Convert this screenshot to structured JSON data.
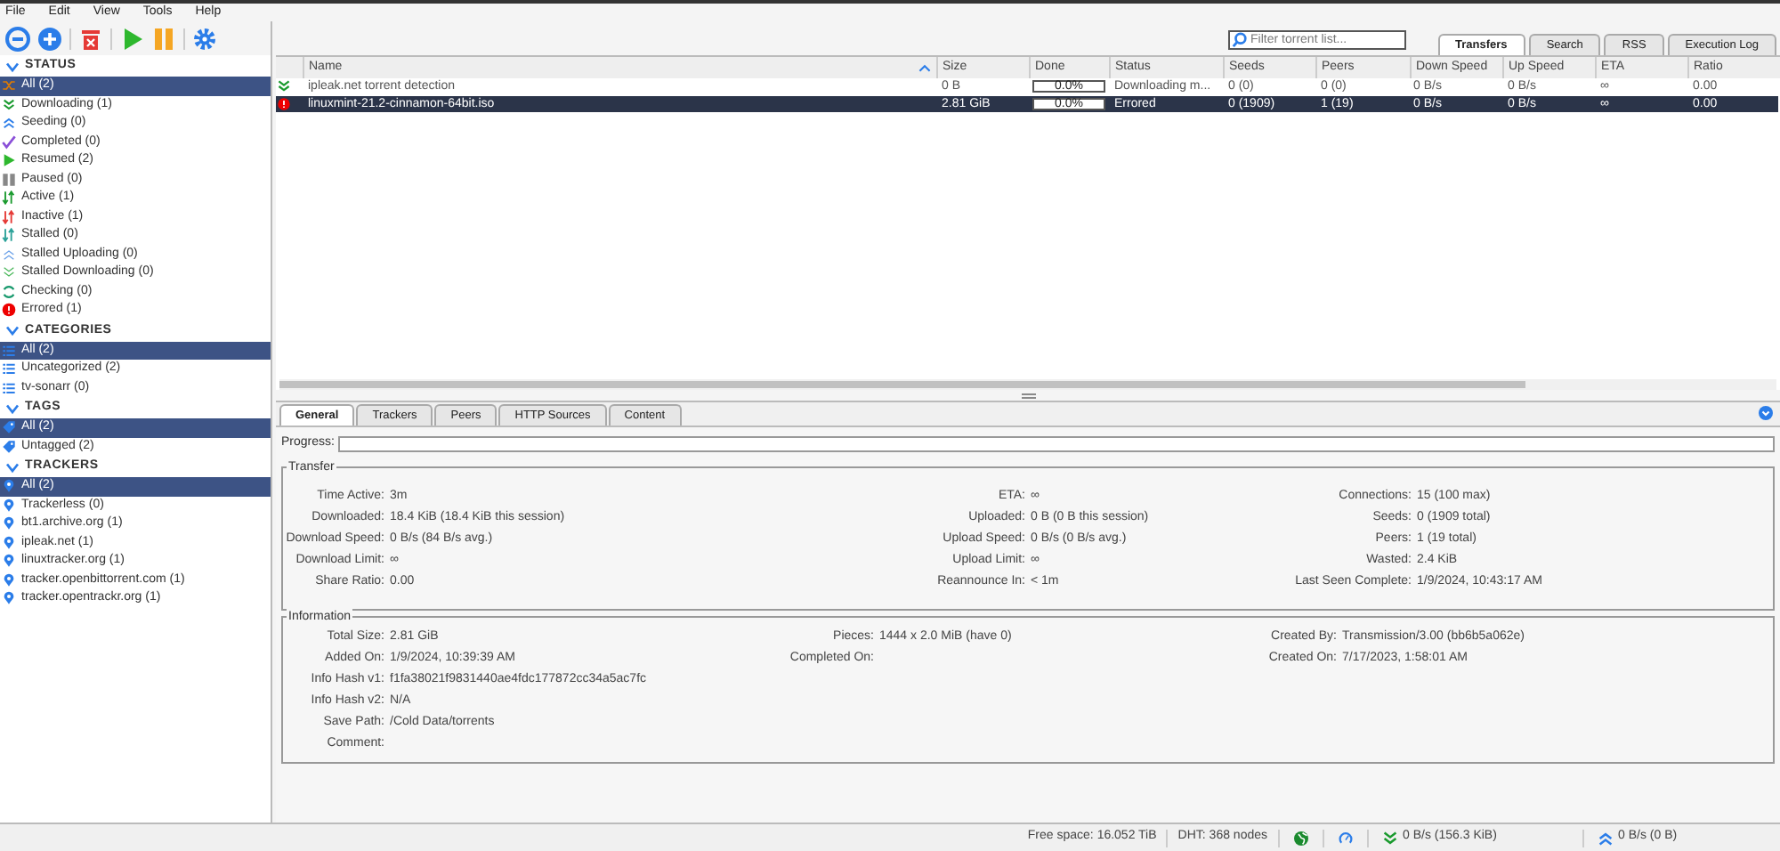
{
  "menu": [
    "File",
    "Edit",
    "View",
    "Tools",
    "Help"
  ],
  "filter": {
    "placeholder": "Filter torrent list..."
  },
  "main_tabs": [
    {
      "label": "Transfers",
      "selected": true
    },
    {
      "label": "Search",
      "selected": false
    },
    {
      "label": "RSS",
      "selected": false
    },
    {
      "label": "Execution Log",
      "selected": false
    }
  ],
  "sidebar": [
    {
      "title": "STATUS",
      "kind": "status",
      "expanded": true,
      "items": [
        {
          "label": "All (2)",
          "selected": true
        },
        {
          "label": "Downloading (1)",
          "selected": false
        },
        {
          "label": "Seeding (0)",
          "selected": false
        },
        {
          "label": "Completed (0)",
          "selected": false
        },
        {
          "label": "Resumed (2)",
          "selected": false
        },
        {
          "label": "Paused (0)",
          "selected": false
        },
        {
          "label": "Active (1)",
          "selected": false
        },
        {
          "label": "Inactive (1)",
          "selected": false
        },
        {
          "label": "Stalled (0)",
          "selected": false
        },
        {
          "label": "Stalled Uploading (0)",
          "selected": false
        },
        {
          "label": "Stalled Downloading (0)",
          "selected": false
        },
        {
          "label": "Checking (0)",
          "selected": false
        },
        {
          "label": "Errored (1)",
          "selected": false
        }
      ]
    },
    {
      "title": "CATEGORIES",
      "kind": "category",
      "expanded": true,
      "items": [
        {
          "label": "All (2)",
          "selected": true
        },
        {
          "label": "Uncategorized (2)",
          "selected": false
        },
        {
          "label": "tv-sonarr (0)",
          "selected": false
        }
      ]
    },
    {
      "title": "TAGS",
      "kind": "tag",
      "expanded": true,
      "items": [
        {
          "label": "All (2)",
          "selected": true
        },
        {
          "label": "Untagged (2)",
          "selected": false
        }
      ]
    },
    {
      "title": "TRACKERS",
      "kind": "tracker",
      "expanded": true,
      "items": [
        {
          "label": "All (2)",
          "selected": true
        },
        {
          "label": "Trackerless (0)",
          "selected": false
        },
        {
          "label": "bt1.archive.org (1)",
          "selected": false
        },
        {
          "label": "ipleak.net (1)",
          "selected": false
        },
        {
          "label": "linuxtracker.org (1)",
          "selected": false
        },
        {
          "label": "tracker.openbittorrent.com (1)",
          "selected": false
        },
        {
          "label": "tracker.opentrackr.org (1)",
          "selected": false
        }
      ]
    }
  ],
  "table": {
    "columns": [
      "Name",
      "Size",
      "Done",
      "Status",
      "Seeds",
      "Peers",
      "Down Speed",
      "Up Speed",
      "ETA",
      "Ratio"
    ],
    "rows": [
      {
        "kind": "downloading",
        "selected": false,
        "name": "ipleak.net torrent detection",
        "size": "0 B",
        "done": "0.0%",
        "level": 0,
        "status": "Downloading m...",
        "seeds": "0 (0)",
        "peers": "0 (0)",
        "down_speed": "0 B/s",
        "up_speed": "0 B/s",
        "eta": "∞",
        "ratio": "0.00"
      },
      {
        "kind": "errored",
        "selected": true,
        "name": "linuxmint-21.2-cinnamon-64bit.iso",
        "size": "2.81 GiB",
        "done": "0.0%",
        "level": 0,
        "status": "Errored",
        "seeds": "0 (1909)",
        "peers": "1 (19)",
        "down_speed": "0 B/s",
        "up_speed": "0 B/s",
        "eta": "∞",
        "ratio": "0.00"
      }
    ]
  },
  "detail_tabs": [
    {
      "label": "General",
      "selected": true
    },
    {
      "label": "Trackers",
      "selected": false
    },
    {
      "label": "Peers",
      "selected": false
    },
    {
      "label": "HTTP Sources",
      "selected": false
    },
    {
      "label": "Content",
      "selected": false
    }
  ],
  "progress": {
    "label": "Progress:",
    "level": 0
  },
  "transfer": {
    "title": "Transfer",
    "rows": [
      [
        {
          "label": "Time Active:",
          "value": "3m"
        },
        {
          "label": "ETA:",
          "value": "∞"
        },
        {
          "label": "Connections:",
          "value": "15 (100 max)"
        }
      ],
      [
        {
          "label": "Downloaded:",
          "value": "18.4 KiB (18.4 KiB this session)"
        },
        {
          "label": "Uploaded:",
          "value": "0 B (0 B this session)"
        },
        {
          "label": "Seeds:",
          "value": "0 (1909 total)"
        }
      ],
      [
        {
          "label": "Download Speed:",
          "value": "0 B/s (84 B/s avg.)"
        },
        {
          "label": "Upload Speed:",
          "value": "0 B/s (0 B/s avg.)"
        },
        {
          "label": "Peers:",
          "value": "1 (19 total)"
        }
      ],
      [
        {
          "label": "Download Limit:",
          "value": "∞"
        },
        {
          "label": "Upload Limit:",
          "value": "∞"
        },
        {
          "label": "Wasted:",
          "value": "2.4 KiB"
        }
      ],
      [
        {
          "label": "Share Ratio:",
          "value": "0.00"
        },
        {
          "label": "Reannounce In:",
          "value": "< 1m"
        },
        {
          "label": "Last Seen Complete:",
          "value": "1/9/2024, 10:43:17 AM"
        }
      ]
    ]
  },
  "information": {
    "title": "Information",
    "rows": [
      [
        {
          "label": "Total Size:",
          "value": "2.81 GiB"
        },
        {
          "label": "Pieces:",
          "value": "1444 x 2.0 MiB (have 0)"
        },
        {
          "label": "Created By:",
          "value": "Transmission/3.00 (bb6b5a062e)"
        }
      ],
      [
        {
          "label": "Added On:",
          "value": "1/9/2024, 10:39:39 AM"
        },
        {
          "label": "Completed On:"
        },
        {
          "label": "Created On:",
          "value": "7/17/2023, 1:58:01 AM"
        }
      ],
      [
        {
          "label": "Info Hash v1:",
          "value": "f1fa38021f9831440ae4fdc177872cc34a5ac7fc"
        }
      ],
      [
        {
          "label": "Info Hash v2:",
          "value": "N/A"
        }
      ],
      [
        {
          "label": "Save Path:",
          "value": "/Cold Data/torrents"
        }
      ],
      [
        {
          "label": "Comment:"
        }
      ]
    ]
  },
  "status_bar": {
    "free_space": "Free space: 16.052 TiB",
    "dht": "DHT: 368 nodes",
    "down": "0 B/s (156.3 KiB)",
    "up": "0 B/s (0 B)"
  }
}
